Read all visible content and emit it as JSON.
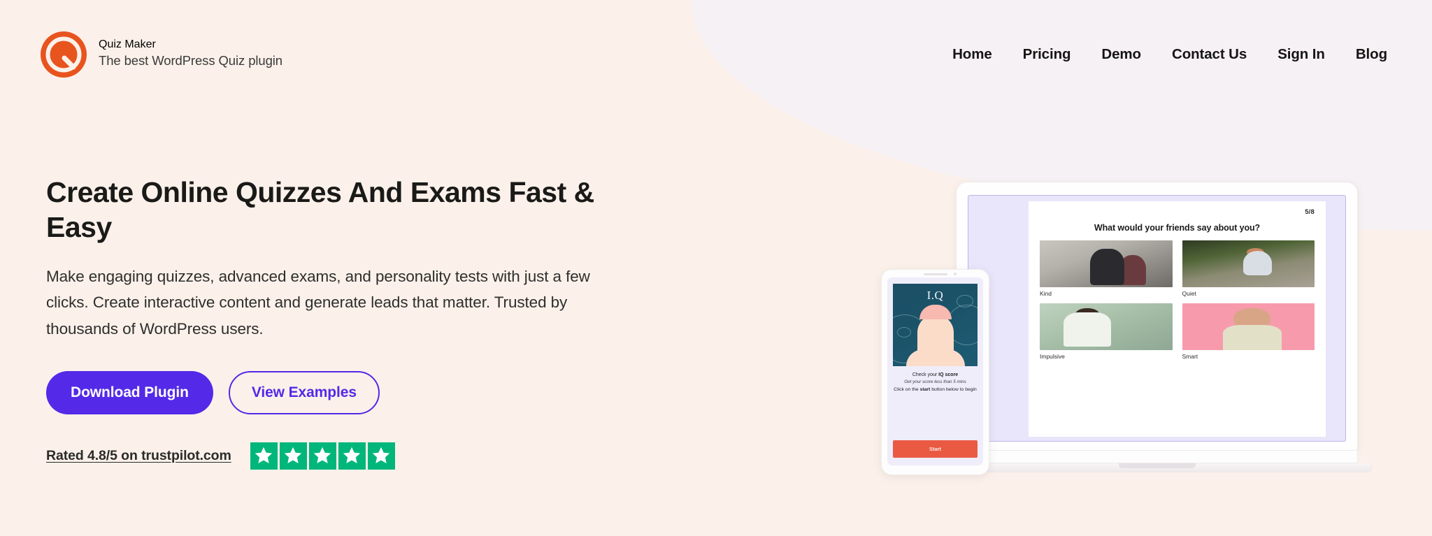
{
  "theme": {
    "bg_cream": "#FBF1EA",
    "bg_pink": "#F6F1F4",
    "brand_orange": "#E8541E",
    "accent_purple": "#5429E8",
    "trustpilot_green": "#00B67A",
    "text_dark": "#1A1A18"
  },
  "header": {
    "logo_icon": "quiz-maker-q-logo-icon",
    "brand_title": "Quiz Maker",
    "brand_subtitle": "The best WordPress Quiz plugin",
    "nav": [
      {
        "label": "Home"
      },
      {
        "label": "Pricing"
      },
      {
        "label": "Demo"
      },
      {
        "label": "Contact Us"
      },
      {
        "label": "Sign In"
      },
      {
        "label": "Blog"
      }
    ]
  },
  "hero": {
    "title": "Create Online Quizzes And Exams Fast & Easy",
    "subtitle": "Make engaging quizzes, advanced exams, and personality tests with just a few clicks. Create interactive content and generate leads that matter. Trusted by thousands of WordPress users.",
    "primary_button": "Download Plugin",
    "secondary_button": "View Examples",
    "rating_text": "Rated 4.8/5 on trustpilot.com",
    "rating_value": "4.8",
    "rating_max": "5",
    "star_count": 5,
    "star_icon": "star-icon"
  },
  "mockup": {
    "laptop": {
      "quiz": {
        "counter": "5/8",
        "question": "What would your friends say about you?",
        "options": [
          {
            "label": "Kind",
            "thumb": "thumb-kind-street-photo"
          },
          {
            "label": "Quiet",
            "thumb": "thumb-quiet-bench-photo"
          },
          {
            "label": "Impulsive",
            "thumb": "thumb-impulsive-desk-photo"
          },
          {
            "label": "Smart",
            "thumb": "thumb-smart-pink-portrait-photo"
          }
        ]
      }
    },
    "phone": {
      "art_label": "I.Q",
      "art_icon": "iq-head-silhouette-illustration",
      "line1_prefix": "Check your ",
      "line1_bold": "IQ score",
      "line2": "Get your score less than 5 mins",
      "line3_prefix": "Click on the ",
      "line3_bold": "start",
      "line3_suffix": " button below to begin",
      "start_button": "Start"
    }
  }
}
